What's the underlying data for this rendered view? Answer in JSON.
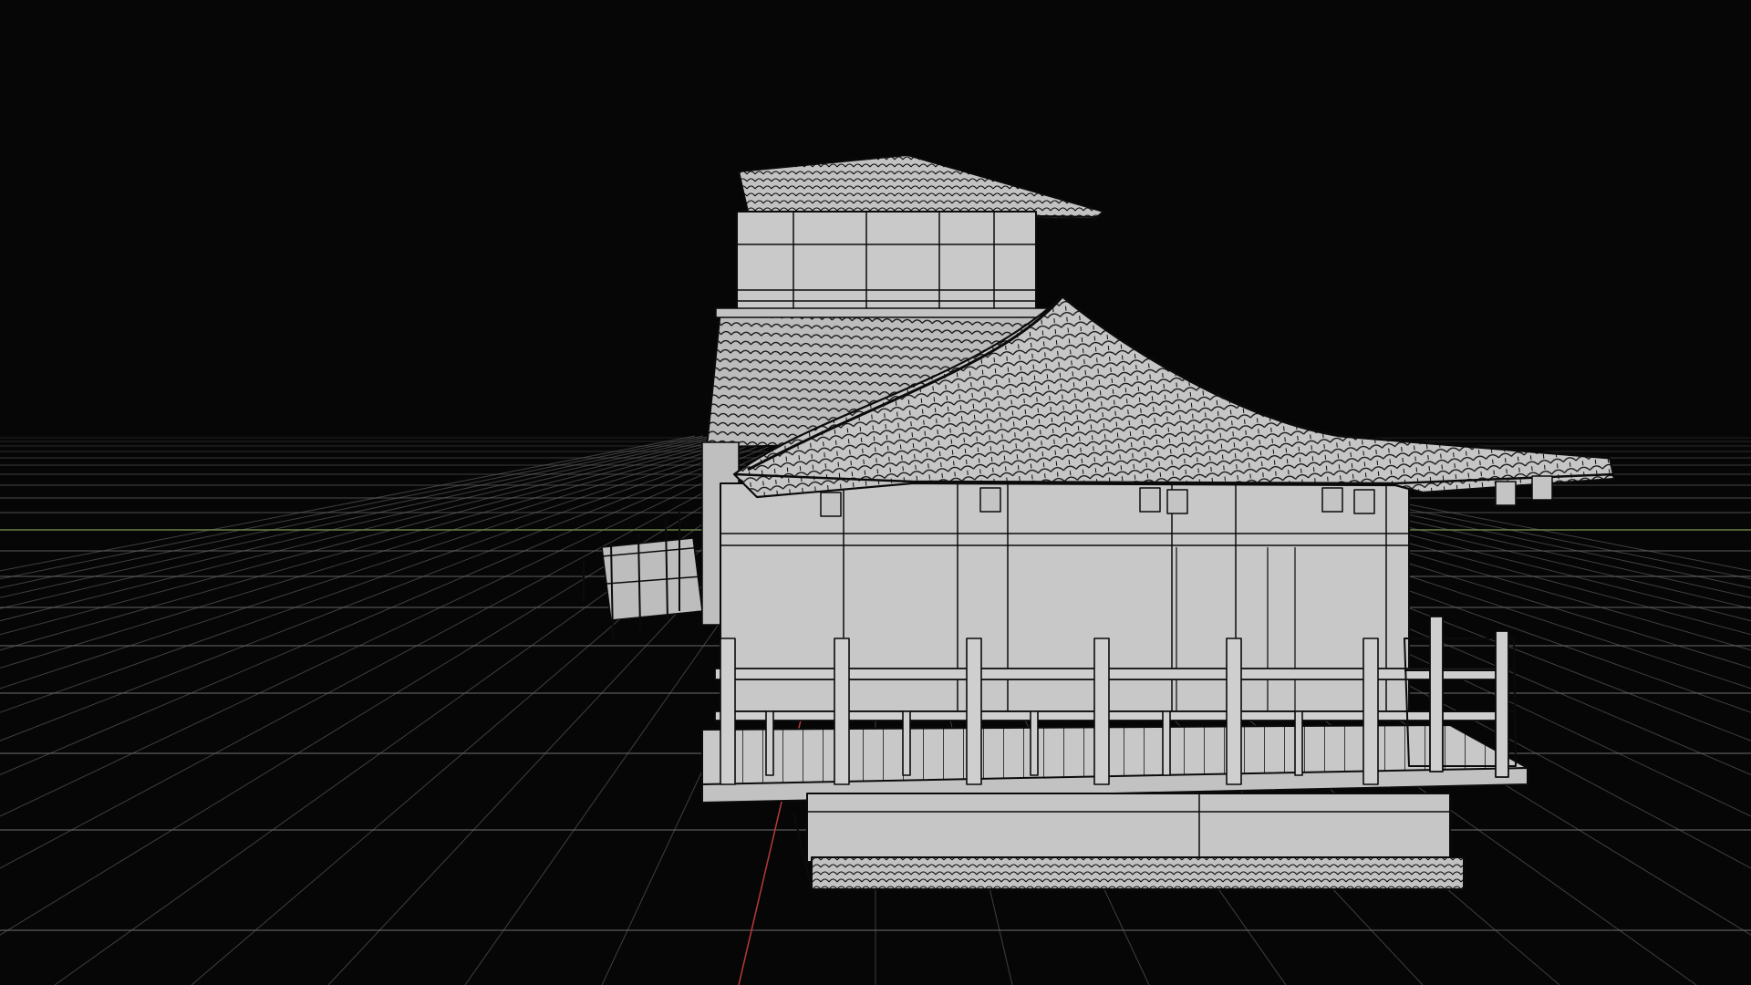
{
  "viewport": {
    "background": "#060606",
    "grid_color": "#6e6e6e",
    "x_axis_color": "#8fa85a",
    "z_axis_color": "#b83a3a",
    "model_fill": "#c4c4c4",
    "model_shade": "#a9a9a9",
    "wire_color": "#0b0b0b",
    "model_description": "wireframe-shaded-pagoda-model"
  }
}
